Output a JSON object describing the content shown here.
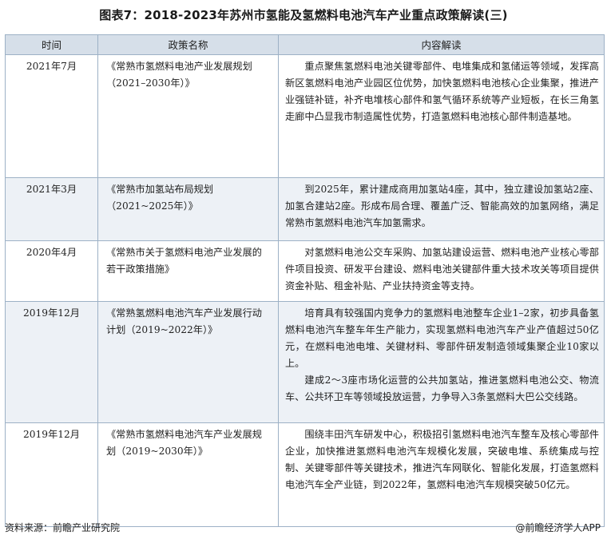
{
  "title": "图表7：2018-2023年苏州市氢能及氢燃料电池汽车产业重点政策解读(三)",
  "table": {
    "headers": [
      "时间",
      "政策名称",
      "内容解读"
    ],
    "rows": [
      {
        "date": "2021年7月",
        "policy": "《常熟市氢燃料电池产业发展规划（2021–2030年）》",
        "content": [
          "重点聚焦氢燃料电池关键零部件、电堆集成和氢储运等领域，发挥高新区氢燃料电池产业园区位优势，加快氢燃料电池核心企业集聚，推进产业强链补链，补齐电堆核心部件和氢气循环系统等产业短板，在长三角氢走廊中凸显我市制造属性优势，打造氢燃料电池核心部件制造基地。"
        ]
      },
      {
        "date": "2021年3月",
        "policy": "《常熟市加氢站布局规划（2021~2025年）》",
        "content": [
          "到2025年，累计建成商用加氢站4座，其中，独立建设加氢站2座、加氢合建站2座。形成布局合理、覆盖广泛、智能高效的加氢网络，满足常熟市氢燃料电池汽车加氢需求。"
        ]
      },
      {
        "date": "2020年4月",
        "policy": "《常熟市关于氢燃料电池产业发展的若干政策措施》",
        "content": [
          "对氢燃料电池公交车采购、加氢站建设运营、燃料电池产业核心零部件项目投资、研发平台建设、燃料电池关键部件重大技术攻关等项目提供资金补贴、租金补贴、产业扶持资金等支持。"
        ]
      },
      {
        "date": "2019年12月",
        "policy": "《常熟氢燃料电池汽车产业发展行动计划（2019~2022年）》",
        "content": [
          "培育具有较强国内竞争力的氢燃料电池整车企业1–2家，初步具备氢燃料电池汽车整车年生产能力，实现氢燃料电池汽车产业产值超过50亿元，在燃料电池电堆、关键材料、零部件研发制造领域集聚企业10家以上。",
          "建成2～3座市场化运营的公共加氢站，推进氢燃料电池公交、物流车、公共环卫车等领域投放运营，力争导入3条氢燃料大巴公交线路。"
        ]
      },
      {
        "date": "2019年12月",
        "policy": "《常熟市氢燃料电池汽车产业发展规划（2019~2030年）》",
        "content": [
          "围绕丰田汽车研发中心，积极招引氢燃料电池汽车整车及核心零部件企业，加快推进氢燃料电池汽车规模化发展，突破电堆、系统集成与控制、关键零部件等关键技术，推进汽车网联化、智能化发展，打造氢燃料电池汽车全产业链，到2022年，氢燃料电池汽车规模突破50亿元。"
        ]
      }
    ]
  },
  "footer": {
    "source": "资料来源：前瞻产业研究院",
    "brand": "@前瞻经济学人APP"
  }
}
